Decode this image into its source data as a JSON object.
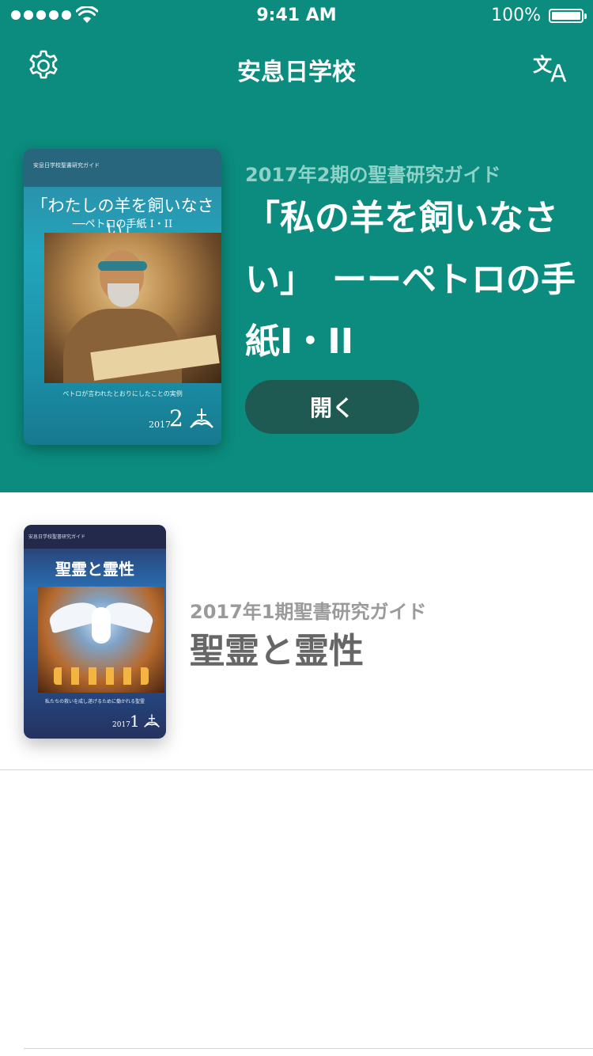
{
  "status_bar": {
    "time": "9:41 AM",
    "battery": "100%",
    "battery_level": 1.0,
    "signal_bars": 5
  },
  "nav": {
    "title": "安息日学校",
    "left_icon": "gear-icon",
    "right_icon": "translate-icon",
    "translate_glyph_a": "文",
    "translate_glyph_b": "A"
  },
  "featured": {
    "subtitle": "2017年2期の聖書研究ガイド",
    "title": "「私の羊を飼いなさい」　ーーペトロの手紙I・II",
    "open_label": "開く",
    "cover": {
      "series": "安息日学校聖書研究ガイド",
      "title": "「わたしの羊を飼いなさい」",
      "subtitle": "──ペトロの手紙 I・II",
      "caption": "ペトロが言われたとおりにしたことの実例",
      "year": "2017",
      "issue": "2"
    }
  },
  "quarterlies": [
    {
      "subtitle": "2017年1期聖書研究ガイド",
      "title": "聖霊と霊性",
      "cover": {
        "series": "安息日学校聖書研究ガイド",
        "title": "聖霊と霊性",
        "caption": "私たちの救いを成し遂げるために働かれる聖霊",
        "year": "2017",
        "issue": "1"
      }
    }
  ],
  "colors": {
    "primary": "#0b8c7e",
    "button": "#1f5a52",
    "subtitle_light": "#8fd2c8",
    "list_title": "#666666",
    "list_subtitle": "#9a9a9a"
  }
}
